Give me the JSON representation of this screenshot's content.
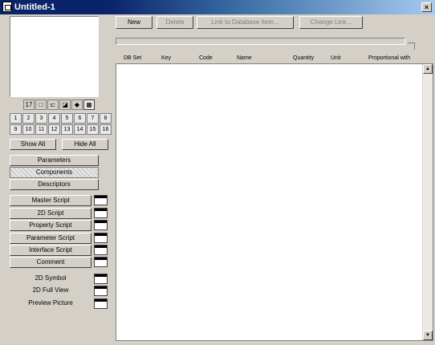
{
  "window": {
    "title": "Untitled-1",
    "close_label": "×"
  },
  "view_icons": [
    "17",
    "□",
    "⊏",
    "◪",
    "◆",
    "▦"
  ],
  "layer_numbers": [
    "1",
    "2",
    "3",
    "4",
    "5",
    "6",
    "7",
    "8",
    "9",
    "10",
    "11",
    "12",
    "13",
    "14",
    "15",
    "16"
  ],
  "buttons": {
    "show_all": "Show All",
    "hide_all": "Hide All"
  },
  "tabs": {
    "parameters": "Parameters",
    "components": "Components",
    "descriptors": "Descriptors"
  },
  "scripts": [
    "Master Script",
    "2D Script",
    "Property Script",
    "Parameter Script",
    "Interface Script",
    "Comment"
  ],
  "views": [
    "2D Symbol",
    "2D Full View",
    "Preview Picture"
  ],
  "toolbar": {
    "new": "New",
    "delete": "Delete",
    "link": "Link to Database Item...",
    "change_link": "Change Link..."
  },
  "columns": [
    "DB Set",
    "Key",
    "Code",
    "Name",
    "Quantity",
    "Unit",
    "Proportional with"
  ],
  "scroll": {
    "up": "▲",
    "down": "▼"
  },
  "colors": {
    "title_active": "#0a246a",
    "face": "#d4d0c8"
  }
}
